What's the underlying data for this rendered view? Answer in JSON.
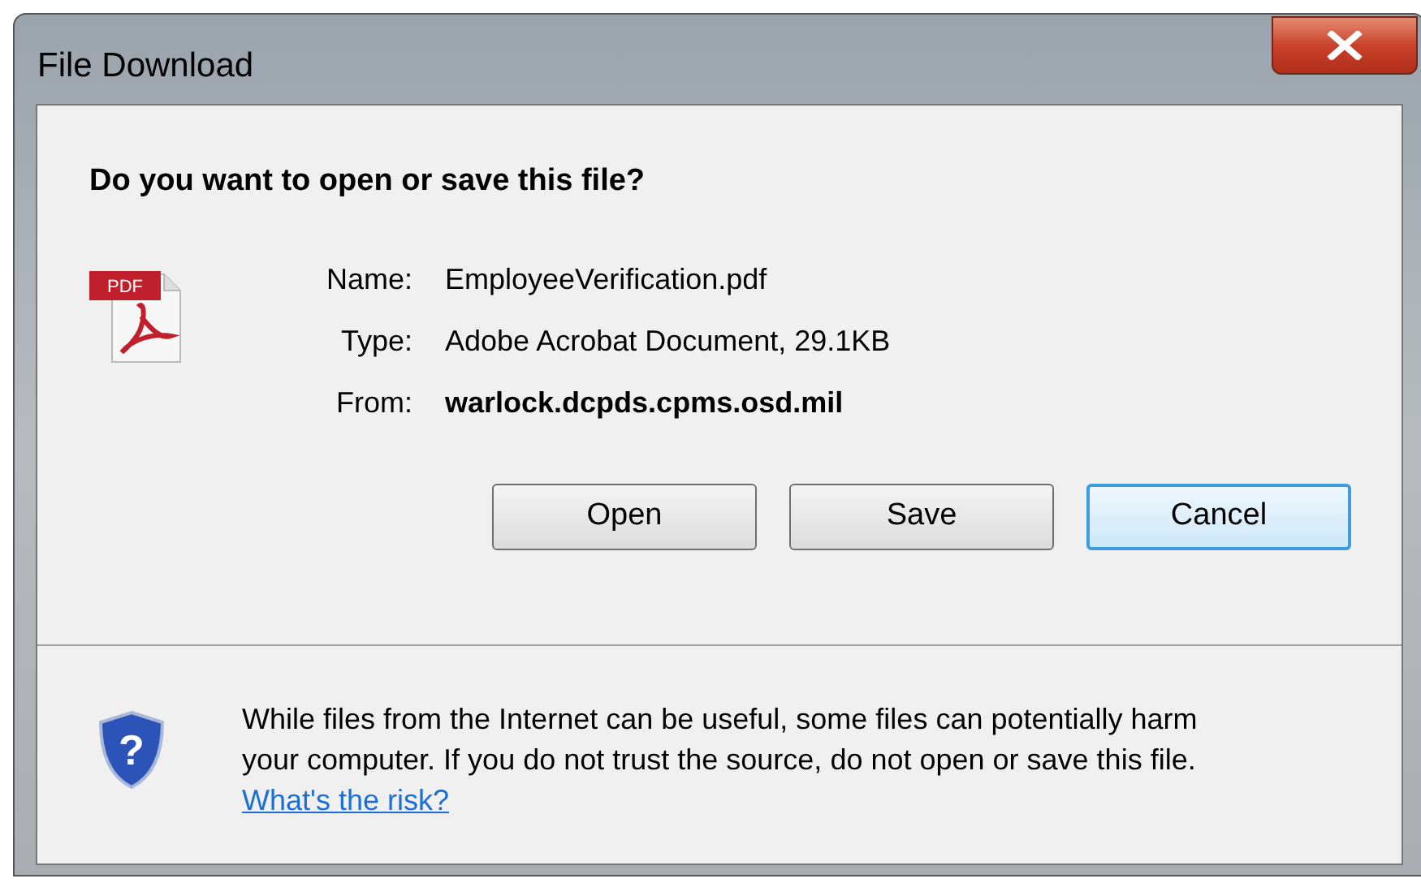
{
  "window": {
    "title": "File Download"
  },
  "heading": "Do you want to open or save this file?",
  "file_icon": {
    "label": "PDF"
  },
  "fields": [
    {
      "label": "Name:",
      "value": "EmployeeVerification.pdf",
      "bold": false
    },
    {
      "label": "Type:",
      "value": "Adobe Acrobat Document, 29.1KB",
      "bold": false
    },
    {
      "label": "From:",
      "value": "warlock.dcpds.cpms.osd.mil",
      "bold": true
    }
  ],
  "buttons": [
    {
      "label": "Open",
      "focused": false
    },
    {
      "label": "Save",
      "focused": false
    },
    {
      "label": "Cancel",
      "focused": true
    }
  ],
  "warning": {
    "icon_glyph": "?",
    "text": "While files from the Internet can be useful, some files can potentially harm your computer. If you do not trust the source, do not open or save this file.",
    "link": "What's the risk?"
  }
}
